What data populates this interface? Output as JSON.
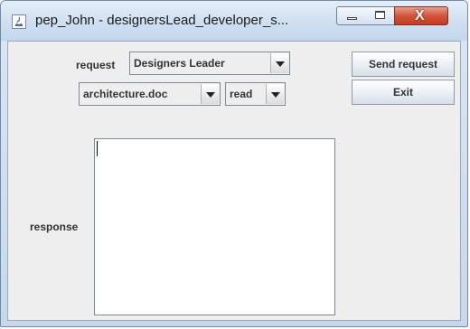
{
  "window": {
    "title": "pep_John - designersLead_developer_s...",
    "controls": {
      "minimize_icon": "minimize-icon",
      "maximize_icon": "maximize-icon",
      "close_icon": "close-icon",
      "close_glyph": "X"
    }
  },
  "form": {
    "request_label": "request",
    "request_value": "Designers Leader",
    "document_value": "architecture.doc",
    "action_value": "read",
    "response_label": "response",
    "response_value": ""
  },
  "buttons": {
    "send_request": "Send request",
    "exit": "Exit"
  },
  "colors": {
    "window_frame": "#c6d8ea",
    "content_bg": "#eeeeee",
    "close_button": "#c43b20"
  }
}
